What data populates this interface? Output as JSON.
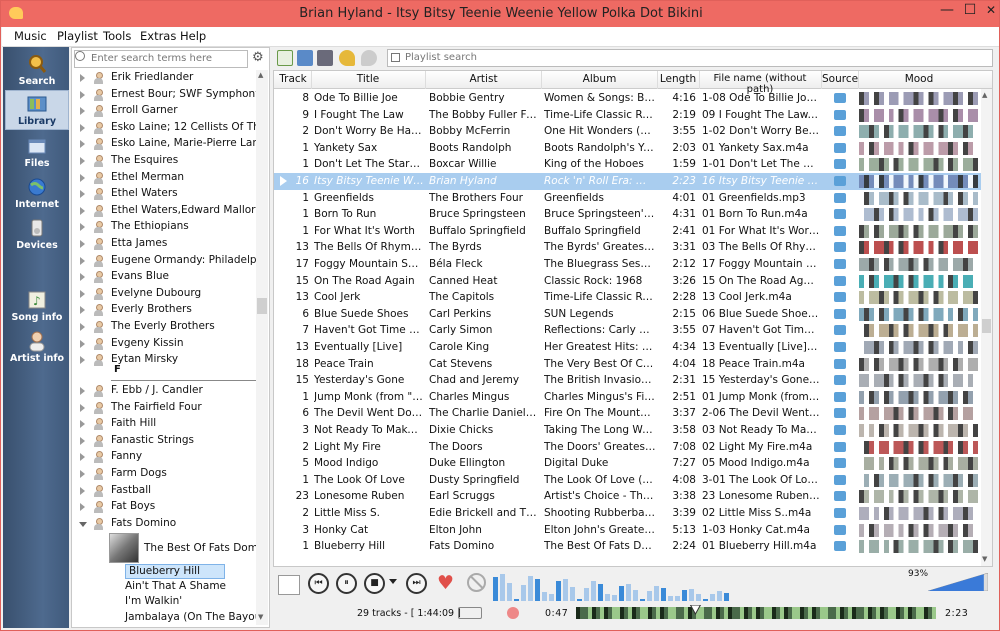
{
  "window": {
    "title": "Brian Hyland - Itsy Bitsy Teenie Weenie Yellow Polka Dot Bikini",
    "minimize": "—",
    "maximize": "☐",
    "close": "✕"
  },
  "menu": [
    "Music",
    "Playlist",
    "Tools",
    "Extras",
    "Help"
  ],
  "sidebar": [
    {
      "label": "Search",
      "icon": "search-icon"
    },
    {
      "label": "Library",
      "icon": "library-icon",
      "active": true
    },
    {
      "label": "Files",
      "icon": "files-icon"
    },
    {
      "label": "Internet",
      "icon": "globe-icon"
    },
    {
      "label": "Devices",
      "icon": "devices-icon"
    },
    {
      "label": "Song info",
      "icon": "song-info-icon"
    },
    {
      "label": "Artist info",
      "icon": "artist-info-icon"
    }
  ],
  "library": {
    "search_placeholder": "Enter search terms here",
    "artists_top": [
      "Erik Friedlander",
      "Ernest Bour; SWF Symphony...",
      "Erroll Garner",
      "Esko Laine; 12 Cellists Of Th...",
      "Esko Laine, Marie-Pierre Lan...",
      "The Esquires",
      "Ethel Merman",
      "Ethel Waters",
      "Ethel Waters,Edward Mallory...",
      "The Ethiopians",
      "Etta James",
      "Eugene Ormandy: Philadelp...",
      "Evans Blue",
      "Evelyne Dubourg",
      "Everly Brothers",
      "The Everly Brothers",
      "Evgeny Kissin",
      "Eytan Mirsky"
    ],
    "letter": "F",
    "artists_f": [
      "F. Ebb / J. Candler",
      "The Fairfield Four",
      "Faith Hill",
      "Fanastic Strings",
      "Fanny",
      "Farm Dogs",
      "Fastball",
      "Fat Boys",
      "Fats Domino"
    ],
    "album": "The Best Of Fats Dom...",
    "songs": [
      "Blueberry Hill",
      "Ain't That A Shame",
      "I'm Walkin'",
      "Jambalaya (On The Bayou)"
    ],
    "selected_song": 0
  },
  "playlist": {
    "search_placeholder": "Playlist search",
    "columns": [
      "Track",
      "Title",
      "Artist",
      "Album",
      "Length",
      "File name (without path)",
      "Source",
      "Mood"
    ],
    "rows": [
      [
        "8",
        "Ode To Billie Joe",
        "Bobbie Gentry",
        "Women & Songs: Beg...",
        "4:16",
        "1-08 Ode To Billie Joe.m..."
      ],
      [
        "9",
        "I Fought The Law",
        "The Bobby Fuller Four",
        "Time-Life Classic Roc...",
        "2:19",
        "09 I Fought The Law.m4a"
      ],
      [
        "2",
        "Don't Worry Be Happy",
        "Bobby McFerrin",
        "One Hit Wonders (Dis...",
        "3:55",
        "1-02 Don't Worry Be Ha..."
      ],
      [
        "1",
        "Yankety Sax",
        "Boots Randolph",
        "Boots Randolph's Yak...",
        "2:03",
        "01 Yankety Sax.m4a"
      ],
      [
        "1",
        "Don't Let The Stars Ge...",
        "Boxcar Willie",
        "King of the Hoboes",
        "1:59",
        "1-01 Don't Let The Stars..."
      ],
      [
        "16",
        "Itsy Bitsy Teenie Ween...",
        "Brian Hyland",
        "Rock 'n' Roll Era: Wer...",
        "2:23",
        "16 Itsy Bitsy Teenie Wee..."
      ],
      [
        "1",
        "Greenfields",
        "The Brothers Four",
        "Greenfields",
        "4:01",
        "01 Greenfields.mp3"
      ],
      [
        "1",
        "Born To Run",
        "Bruce Springsteen",
        "Bruce Springsteen's G...",
        "4:31",
        "01 Born To Run.m4a"
      ],
      [
        "1",
        "For What It's Worth",
        "Buffalo Springfield",
        "Buffalo Springfield",
        "2:41",
        "01 For What It's Worth...."
      ],
      [
        "13",
        "The Bells Of Rhymney",
        "The Byrds",
        "The Byrds' Greatest Hits",
        "3:31",
        "03 The Bells Of Rhymne..."
      ],
      [
        "17",
        "Foggy Mountain Spec...",
        "Béla Fleck",
        "The Bluegrass Session...",
        "2:12",
        "17 Foggy Mountain Spe..."
      ],
      [
        "15",
        "On The Road Again",
        "Canned Heat",
        "Classic Rock: 1968",
        "3:26",
        "15 On The Road Again...."
      ],
      [
        "13",
        "Cool Jerk",
        "The Capitols",
        "Time-Life Classic Roc...",
        "2:28",
        "13 Cool Jerk.m4a"
      ],
      [
        "6",
        "Blue Suede Shoes",
        "Carl Perkins",
        "SUN Legends",
        "2:15",
        "06 Blue Suede Shoes.mp3"
      ],
      [
        "7",
        "Haven't Got Time For ...",
        "Carly Simon",
        "Reflections: Carly Sim...",
        "3:55",
        "07 Haven't Got Time Fo..."
      ],
      [
        "13",
        "Eventually [Live]",
        "Carole King",
        "Her Greatest Hits: Son...",
        "4:34",
        "13 Eventually [Live].m4a"
      ],
      [
        "18",
        "Peace Train",
        "Cat Stevens",
        "The Very Best Of Cat ...",
        "4:04",
        "18 Peace Train.m4a"
      ],
      [
        "15",
        "Yesterday's Gone",
        "Chad and Jeremy",
        "The British Invasion: T...",
        "2:31",
        "15 Yesterday's Gone.m4a"
      ],
      [
        "1",
        "Jump Monk (from \"Dr...",
        "Charles Mingus",
        "Charles Mingus's Fine...",
        "2:51",
        "01 Jump Monk (from ..."
      ],
      [
        "6",
        "The Devil Went Down...",
        "The Charlie Daniels B...",
        "Fire On The Mountain...",
        "3:37",
        "2-06 The Devil Went Do..."
      ],
      [
        "3",
        "Not Ready To Make N...",
        "Dixie Chicks",
        "Taking The Long Way ...",
        "3:58",
        "03 Not Ready To Make ..."
      ],
      [
        "2",
        "Light My Fire",
        "The Doors",
        "The Doors' Greatest H...",
        "7:08",
        "02 Light My Fire.m4a"
      ],
      [
        "5",
        "Mood Indigo",
        "Duke Ellington",
        "Digital Duke",
        "7:27",
        "05 Mood Indigo.m4a"
      ],
      [
        "1",
        "The Look Of Love",
        "Dusty Springfield",
        "The Look Of Love (Dis...",
        "4:08",
        "3-01 The Look Of Love...."
      ],
      [
        "23",
        "Lonesome Ruben",
        "Earl Scruggs",
        "Artist's Choice -  The ...",
        "3:38",
        "23 Lonesome Ruben.m4a"
      ],
      [
        "2",
        "Little Miss S.",
        "Edie Brickell and The ...",
        "Shooting Rubberband...",
        "3:39",
        "02 Little Miss S..m4a"
      ],
      [
        "3",
        "Honky Cat",
        "Elton John",
        "Elton John's Greatest ...",
        "5:13",
        "1-03 Honky Cat.m4a"
      ],
      [
        "1",
        "Blueberry Hill",
        "Fats Domino",
        "The Best Of Fats Domi...",
        "2:24",
        "01 Blueberry Hill.m4a"
      ]
    ],
    "playing_row": 5,
    "mood_colors": [
      "#8a8aa8",
      "#9a7a9a",
      "#7aa0a0",
      "#b08a9a",
      "#8aa08a",
      "#6a80b0",
      "#9ab0c0",
      "#a0b0c8",
      "#8a9a88",
      "#b03030",
      "#8a9a9a",
      "#2aa0a8",
      "#b0b090",
      "#6a9ab0",
      "#b0a080",
      "#909aa8",
      "#a0a0a0",
      "#9aa0a8",
      "#8090a0",
      "#a89090",
      "#b0a8a0",
      "#b03a3a",
      "#98a090",
      "#8aa0a8",
      "#a0a898",
      "#a0a0b0",
      "#a8a0a8",
      "#88a098"
    ]
  },
  "controls": {
    "volume": "93%",
    "volume_level": 0.93,
    "track_count": "29 tracks - [ 1:44:09 ]",
    "time_elapsed": "0:47",
    "time_remaining": "2:23",
    "seek_position": 0.33
  }
}
